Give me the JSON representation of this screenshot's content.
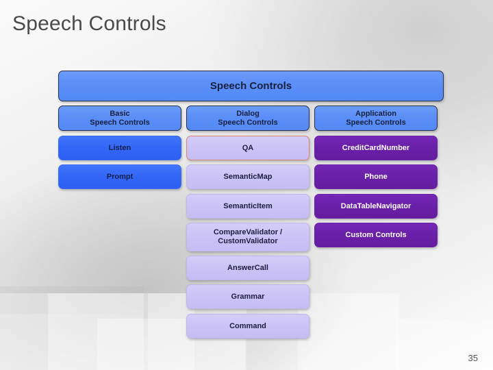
{
  "slide": {
    "title": "Speech Controls",
    "page_number": "35"
  },
  "diagram": {
    "header": {
      "label": "Speech Controls"
    },
    "columns": [
      {
        "name": "basic",
        "header": "Basic\nSpeech Controls",
        "header_line1": "Basic",
        "header_line2": "Speech Controls",
        "items": [
          {
            "label": "Listen",
            "style": "blue"
          },
          {
            "label": "Prompt",
            "style": "blue"
          }
        ]
      },
      {
        "name": "dialog",
        "header": "Dialog\nSpeech Controls",
        "header_line1": "Dialog",
        "header_line2": "Speech Controls",
        "items": [
          {
            "label": "QA",
            "style": "lavender-highlight"
          },
          {
            "label": "SemanticMap",
            "style": "lavender"
          },
          {
            "label": "SemanticItem",
            "style": "lavender"
          },
          {
            "label": "CompareValidator /\nCustomValidator",
            "style": "lavender",
            "line1": "CompareValidator /",
            "line2": "CustomValidator"
          },
          {
            "label": "AnswerCall",
            "style": "lavender"
          },
          {
            "label": "Grammar",
            "style": "lavender"
          },
          {
            "label": "Command",
            "style": "lavender"
          }
        ]
      },
      {
        "name": "application",
        "header": "Application\nSpeech Controls",
        "header_line1": "Application",
        "header_line2": "Speech Controls",
        "items": [
          {
            "label": "CreditCardNumber",
            "style": "purple"
          },
          {
            "label": "Phone",
            "style": "purple"
          },
          {
            "label": "DataTableNavigator",
            "style": "purple"
          },
          {
            "label": "Custom Controls",
            "style": "purple"
          }
        ]
      }
    ]
  },
  "colors": {
    "header_blue": "#5B8DF6",
    "leaf_blue": "#3366F6",
    "lavender": "#CBC3F5",
    "lavender_highlight_border": "#D98578",
    "purple": "#6A1FA8",
    "title_gray": "#4A4A4A"
  }
}
